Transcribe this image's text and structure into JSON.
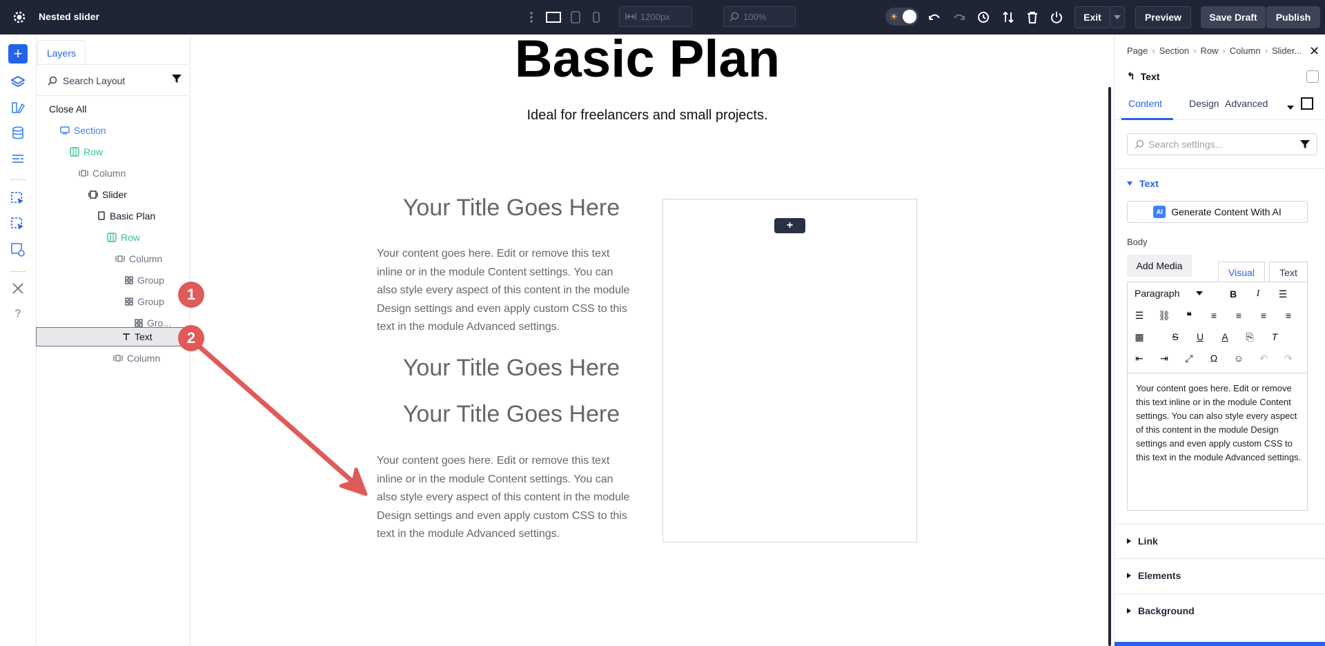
{
  "topbar": {
    "title": "Nested slider",
    "width_placeholder": "1200px",
    "zoom_placeholder": "100%",
    "exit_label": "Exit",
    "preview_label": "Preview",
    "save_draft_label": "Save Draft",
    "publish_label": "Publish"
  },
  "layers": {
    "tab_label": "Layers",
    "search_placeholder": "Search Layout",
    "close_all": "Close All",
    "items": [
      {
        "label": "Section"
      },
      {
        "label": "Row"
      },
      {
        "label": "Column"
      },
      {
        "label": "Slider"
      },
      {
        "label": "Basic Plan"
      },
      {
        "label": "Row"
      },
      {
        "label": "Column"
      },
      {
        "label": "Group"
      },
      {
        "label": "Group"
      },
      {
        "label": "Gro..."
      },
      {
        "label": "Text"
      },
      {
        "label": "Column"
      }
    ]
  },
  "markers": [
    "1",
    "2"
  ],
  "canvas": {
    "heading": "Basic Plan",
    "subheading": "Ideal for freelancers and small projects.",
    "title_1": "Your Title Goes Here",
    "body_1": "Your content goes here. Edit or remove this text inline or in the module Content settings. You can also style every aspect of this content in the module Design settings and even apply custom CSS to this text in the module Advanced settings.",
    "title_2": "Your Title Goes Here",
    "title_3": "Your Title Goes Here",
    "body_2": "Your content goes here. Edit or remove this text inline or in the module Content settings. You can also style every aspect of this content in the module Design settings and even apply custom CSS to this text in the module Advanced settings.",
    "add_module": "+"
  },
  "settings": {
    "breadcrumbs": [
      "Page",
      "Section",
      "Row",
      "Column",
      "Slider..."
    ],
    "module_title": "Text",
    "tabs": [
      "Content",
      "Design",
      "Advanced"
    ],
    "search_placeholder": "Search settings...",
    "text_section": "Text",
    "ai_button": "Generate Content With AI",
    "ai_badge": "AI",
    "body_label": "Body",
    "add_media": "Add Media",
    "visual_tab": "Visual",
    "text_tab": "Text",
    "paragraph_select": "Paragraph",
    "editor_content": "Your content goes here. Edit or remove this text inline or in the module Content settings. You can also style every aspect of this content in the module Design settings and even apply custom CSS to this text in the module Advanced settings.",
    "sections": [
      "Link",
      "Elements",
      "Background"
    ]
  },
  "colors": {
    "topbar_bg": "#1f2535",
    "accent_blue": "#2563eb",
    "layer_green": "#34c391",
    "marker_red": "#e05a5a"
  }
}
